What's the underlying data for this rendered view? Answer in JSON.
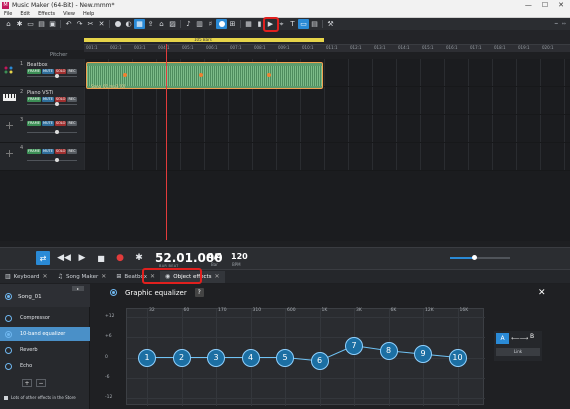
{
  "window": {
    "title": "Music Maker (64-Bit) - New.mmm*",
    "logo": "M",
    "controls": [
      "—",
      "☐",
      "✕"
    ]
  },
  "menu": [
    "File",
    "Edit",
    "Effects",
    "View",
    "Help"
  ],
  "loop_range_label": "105 Bars",
  "ruler_ticks": [
    "001:1",
    "002:1",
    "003:1",
    "004:1",
    "005:1",
    "006:1",
    "007:1",
    "008:1",
    "009:1",
    "010:1",
    "011:1",
    "012:1",
    "013:1",
    "014:1",
    "015:1",
    "016:1",
    "017:1",
    "018:1",
    "019:1",
    "020:1"
  ],
  "pitch_label": "Pitcher",
  "tracks": [
    {
      "num": "1",
      "name": "Beatbox",
      "buttons": [
        "FRAME",
        "MUTE",
        "SOLO",
        "REC"
      ]
    },
    {
      "num": "2",
      "name": "Piano VSTi",
      "buttons": [
        "FRAME",
        "MUTE",
        "SOLO",
        "REC"
      ]
    },
    {
      "num": "3",
      "name": "",
      "buttons": [
        "FRAME",
        "MUTE",
        "SOLO",
        "REC"
      ]
    },
    {
      "num": "4",
      "name": "",
      "buttons": [
        "FRAME",
        "MUTE",
        "SOLO",
        "REC"
      ]
    }
  ],
  "clip": {
    "name": "Song_01.mp3 [0]"
  },
  "transport": {
    "time": "52.01.000",
    "time_sub": "BAR BEAT",
    "signature": "4/4",
    "signature_sub": "Bar",
    "bpm": "120",
    "bpm_sub": "BPM",
    "master_level": 0.4
  },
  "tabs": [
    {
      "icon": "keyboard-icon",
      "label": "Keyboard"
    },
    {
      "icon": "song-maker-icon",
      "label": "Song Maker"
    },
    {
      "icon": "beatbox-icon",
      "label": "Beatbox"
    },
    {
      "icon": "object-effects-icon",
      "label": "Object effects",
      "active": true
    }
  ],
  "effects_panel": {
    "song": "Song_01",
    "effects": [
      {
        "label": "Compressor",
        "selected": false
      },
      {
        "label": "10-band equalizer",
        "selected": true
      },
      {
        "label": "Reverb",
        "selected": false
      },
      {
        "label": "Echo",
        "selected": false
      }
    ],
    "add_label": "+",
    "remove_label": "−",
    "store_label": "Lots of other effects in the Store"
  },
  "equalizer": {
    "title": "Graphic equalizer",
    "help": "?",
    "close": "✕",
    "freq_labels": [
      "32",
      "60",
      "170",
      "310",
      "600",
      "1K",
      "3K",
      "6K",
      "12K",
      "16K"
    ],
    "db_labels": [
      "+12",
      "+6",
      "0",
      "-6",
      "-12"
    ],
    "bands": [
      {
        "label": "1",
        "gain_db": 0
      },
      {
        "label": "2",
        "gain_db": 0
      },
      {
        "label": "3",
        "gain_db": 0
      },
      {
        "label": "4",
        "gain_db": 0
      },
      {
        "label": "5",
        "gain_db": 0
      },
      {
        "label": "6",
        "gain_db": -1
      },
      {
        "label": "7",
        "gain_db": 3.5
      },
      {
        "label": "8",
        "gain_db": 2
      },
      {
        "label": "9",
        "gain_db": 1
      },
      {
        "label": "10",
        "gain_db": 0
      }
    ],
    "ab": {
      "a": "A",
      "b": "B",
      "arrow": "⟵⟶",
      "link": "Link"
    }
  },
  "colors": {
    "accent": "#2a8ad6",
    "highlight": "#e0201e",
    "clip": "#5d9b6d",
    "loop": "#e6d44a"
  }
}
